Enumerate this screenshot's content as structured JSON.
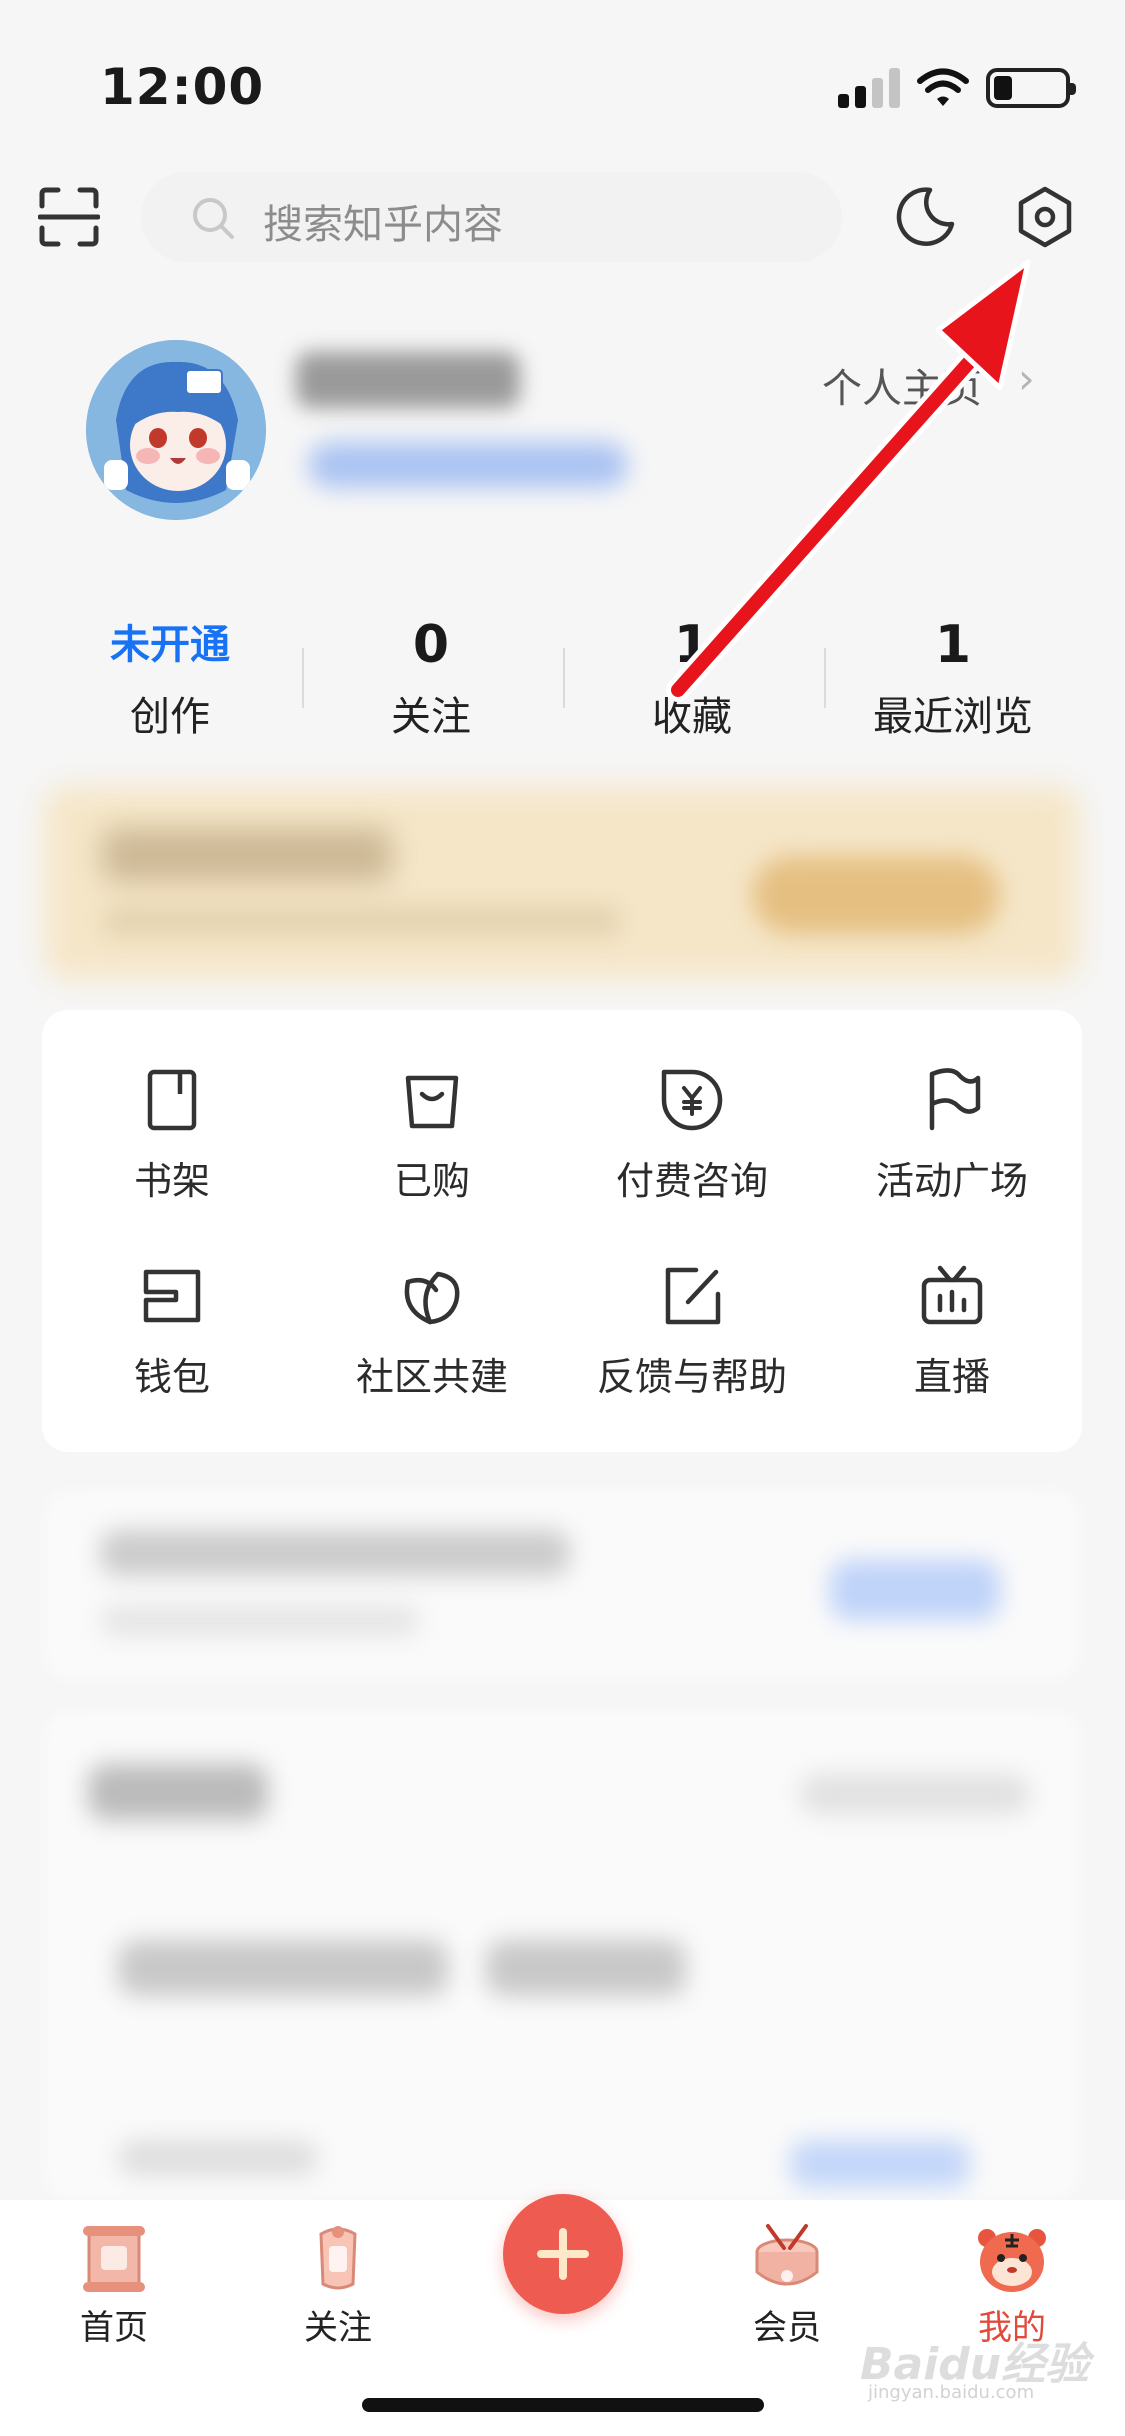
{
  "status_bar": {
    "time": "12:00"
  },
  "header": {
    "search_placeholder": "搜索知乎内容",
    "icons": [
      "scan-icon",
      "search-icon",
      "night-mode-icon",
      "settings-icon"
    ]
  },
  "profile": {
    "link_label": "个人主页",
    "arrow": "›"
  },
  "stats": [
    {
      "value": "未开通",
      "label": "创作"
    },
    {
      "value": "0",
      "label": "关注"
    },
    {
      "value": "1",
      "label": "收藏"
    },
    {
      "value": "1",
      "label": "最近浏览"
    }
  ],
  "tools": [
    {
      "label": "书架",
      "icon": "bookshelf-icon"
    },
    {
      "label": "已购",
      "icon": "shopping-bag-icon"
    },
    {
      "label": "付费咨询",
      "icon": "paid-consult-icon"
    },
    {
      "label": "活动广场",
      "icon": "flag-icon"
    },
    {
      "label": "钱包",
      "icon": "wallet-icon"
    },
    {
      "label": "社区共建",
      "icon": "leaf-icon"
    },
    {
      "label": "反馈与帮助",
      "icon": "feedback-icon"
    },
    {
      "label": "直播",
      "icon": "live-tv-icon"
    }
  ],
  "tabbar": {
    "items": [
      {
        "label": "首页",
        "icon": "home-scroll-icon"
      },
      {
        "label": "关注",
        "icon": "follow-scroll-icon"
      },
      {
        "label": "",
        "icon": "plus-icon"
      },
      {
        "label": "会员",
        "icon": "member-drum-icon"
      },
      {
        "label": "我的",
        "icon": "profile-tiger-icon"
      }
    ]
  },
  "watermark": {
    "text": "Baidu经验",
    "sub": "jingyan.baidu.com"
  },
  "colors": {
    "accent_blue": "#1772f6",
    "brand_red": "#ee5b50",
    "annotation_red": "#e8141c"
  }
}
